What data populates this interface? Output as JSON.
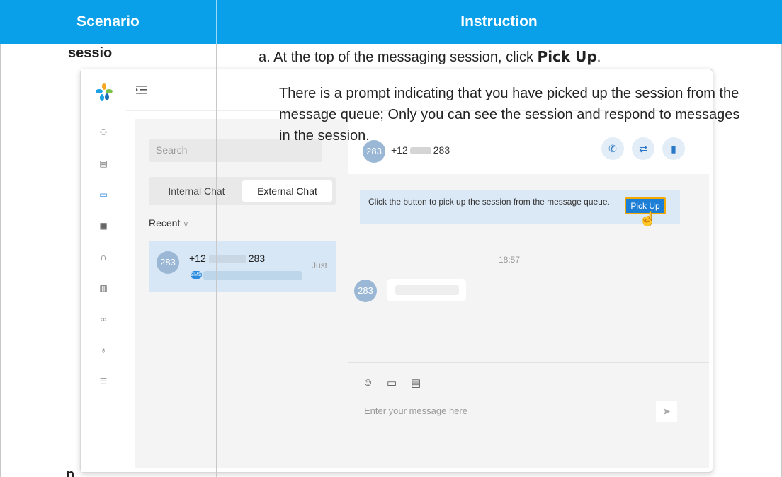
{
  "table": {
    "header": {
      "scenario": "Scenario",
      "instruction": "Instruction"
    },
    "scenario_fragment_top": "sessio",
    "scenario_fragment_bottom": "n",
    "step": {
      "prefix": "a. At the top of the messaging session, click ",
      "action": "Pick Up",
      "suffix": "."
    },
    "paragraph": "There is a prompt indicating that you have picked up the session from the message queue; Only you can see the session and respond to messages in the session."
  },
  "screenshot": {
    "rail_icons": [
      "contacts-icon",
      "phonebook-icon",
      "chat-icon",
      "monitor-icon",
      "headset-icon",
      "report-icon",
      "voicemail-icon",
      "recording-icon",
      "settings-icon"
    ],
    "search_placeholder": "Search",
    "tabs": {
      "internal": "Internal Chat",
      "external": "External Chat"
    },
    "recent_label": "Recent",
    "conversation": {
      "avatar": "283",
      "name_prefix": "+12",
      "name_suffix": "283",
      "time": "Just",
      "channel": "SMS"
    },
    "chat_header": {
      "avatar": "283",
      "name_prefix": "+12",
      "name_suffix": "283"
    },
    "notice": {
      "text": "Click the button to pick up the session from the message queue.",
      "button": "Pick Up"
    },
    "message_time": "18:57",
    "message_avatar": "283",
    "compose_placeholder": "Enter your message here"
  },
  "colors": {
    "header_blue": "#0aa0e9",
    "accent_blue": "#1d7ed6",
    "highlight_orange": "#f2a900"
  }
}
